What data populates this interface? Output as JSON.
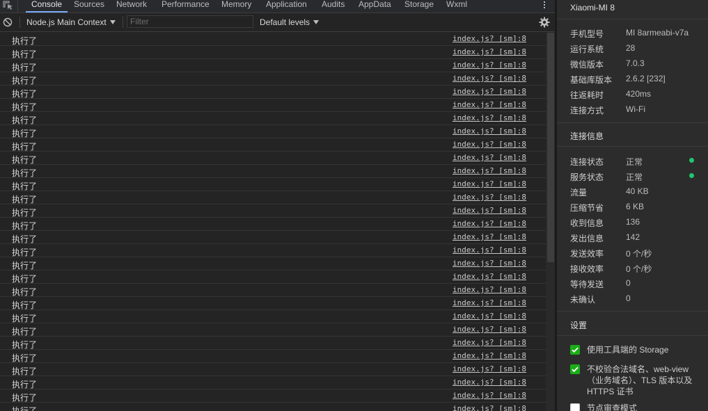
{
  "tabs": [
    "Console",
    "Sources",
    "Network",
    "Performance",
    "Memory",
    "Application",
    "Audits",
    "AppData",
    "Storage",
    "Wxml"
  ],
  "active_tab": "Console",
  "toolbar": {
    "context_label": "Node.js Main Context",
    "filter_placeholder": "Filter",
    "levels_label": "Default levels"
  },
  "log": {
    "message": "执行了",
    "source": "index.js? [sm]:8",
    "rows": 29
  },
  "device": {
    "name": "Xiaomi-MI 8",
    "info": [
      {
        "key": "手机型号",
        "value": "MI 8armeabi-v7a"
      },
      {
        "key": "运行系统",
        "value": "28"
      },
      {
        "key": "微信版本",
        "value": "7.0.3"
      },
      {
        "key": "基础库版本",
        "value": "2.6.2 [232]"
      },
      {
        "key": "往返耗时",
        "value": "420ms"
      },
      {
        "key": "连接方式",
        "value": "Wi-Fi"
      }
    ]
  },
  "connection": {
    "title": "连接信息",
    "items": [
      {
        "key": "连接状态",
        "value": "正常",
        "status": true
      },
      {
        "key": "服务状态",
        "value": "正常",
        "status": true
      },
      {
        "key": "流量",
        "value": "40 KB"
      },
      {
        "key": "压缩节省",
        "value": "6 KB"
      },
      {
        "key": "收到信息",
        "value": "136"
      },
      {
        "key": "发出信息",
        "value": "142"
      },
      {
        "key": "发送效率",
        "value": "0 个/秒"
      },
      {
        "key": "接收效率",
        "value": "0 个/秒"
      },
      {
        "key": "等待发送",
        "value": "0"
      },
      {
        "key": "未确认",
        "value": "0"
      }
    ]
  },
  "settings": {
    "title": "设置",
    "options": [
      {
        "label": "使用工具端的 Storage",
        "checked": true
      },
      {
        "label": "不校验合法域名、web-view（业务域名）、TLS 版本以及 HTTPS 证书",
        "checked": true
      },
      {
        "label": "节点审查模式",
        "checked": false
      }
    ]
  },
  "colors": {
    "accent_tab": "#7cacf8",
    "status_ok": "#1ec76b",
    "checkbox": "#1aad19"
  }
}
